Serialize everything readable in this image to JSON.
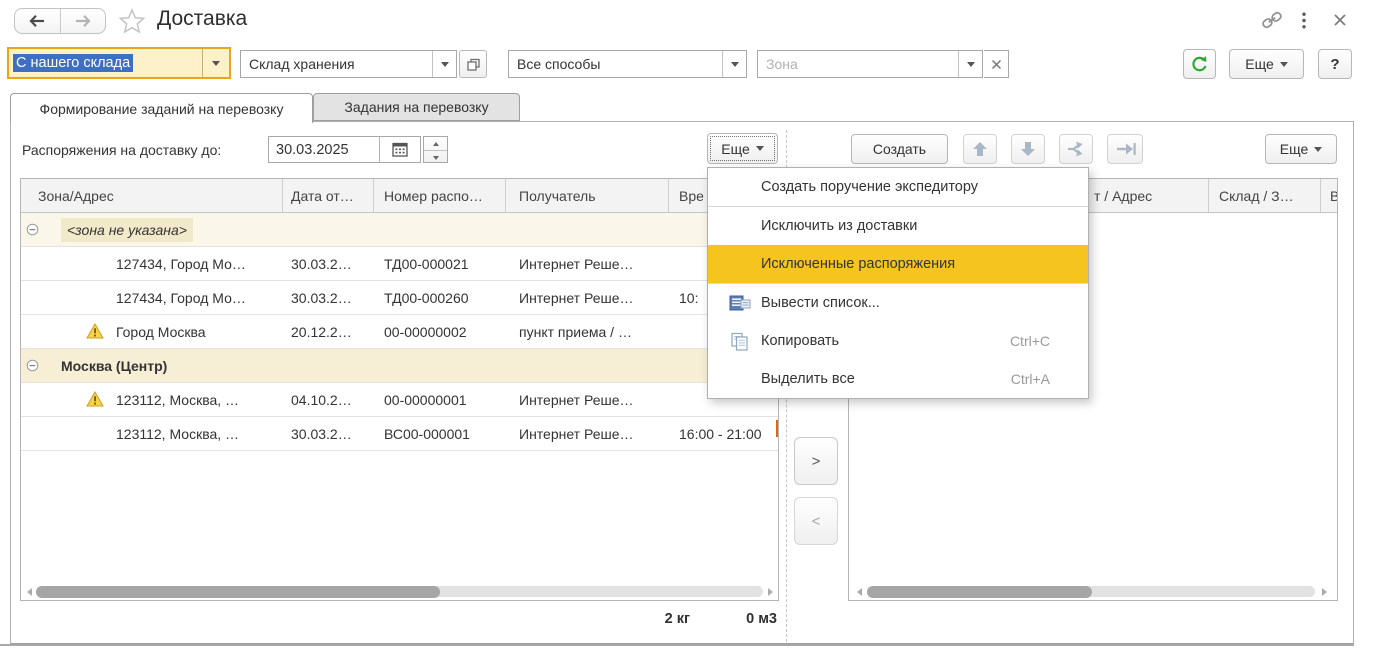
{
  "header": {
    "title": "Доставка"
  },
  "filterbar": {
    "delivery_type": {
      "value": "С нашего склада"
    },
    "warehouse": {
      "value": "Склад хранения"
    },
    "methods": {
      "value": "Все способы"
    },
    "zone": {
      "placeholder": "Зона"
    },
    "more_label": "Еще",
    "help_label": "?"
  },
  "tabs": [
    {
      "label": "Формирование заданий на перевозку",
      "active": true
    },
    {
      "label": "Задания на перевозку",
      "active": false
    }
  ],
  "toolbar": {
    "date_label": "Распоряжения на доставку до:",
    "date_value": "30.03.2025",
    "more_label": "Еще"
  },
  "right_toolbar": {
    "create_label": "Создать",
    "more_label": "Еще"
  },
  "left_table": {
    "columns": [
      "Зона/Адрес",
      "Дата от…",
      "Номер распо…",
      "Получатель",
      "Вре"
    ],
    "rows": [
      {
        "type": "group",
        "label": "<зона не указана>",
        "style": "italic"
      },
      {
        "type": "data",
        "warning": false,
        "address": "127434, Город Мо…",
        "date": "30.03.2…",
        "number": "ТД00-000021",
        "recipient": "Интернет Реше…",
        "time": ""
      },
      {
        "type": "data",
        "warning": false,
        "address": "127434, Город Мо…",
        "date": "30.03.2…",
        "number": "ТД00-000260",
        "recipient": "Интернет Реше…",
        "time": "10:"
      },
      {
        "type": "data",
        "warning": true,
        "address": "Город Москва",
        "date": "20.12.2…",
        "number": "00-00000002",
        "recipient": "пункт приема / …",
        "time": ""
      },
      {
        "type": "group",
        "label": "Москва (Центр)",
        "style": "bold"
      },
      {
        "type": "data",
        "warning": true,
        "address": "123112, Москва, …",
        "date": "04.10.2…",
        "number": "00-00000001",
        "recipient": "Интернет Реше…",
        "time": ""
      },
      {
        "type": "data",
        "warning": false,
        "address": "123112, Москва, …",
        "date": "30.03.2…",
        "number": "ВС00-000001",
        "recipient": "Интернет Реше…",
        "time": "16:00 - 21:00"
      }
    ],
    "totals": {
      "weight": "2 кг",
      "volume": "0 м3"
    }
  },
  "right_table": {
    "columns": [
      "т / Адрес",
      "Склад / З…",
      "В"
    ]
  },
  "transfer": {
    "right": ">",
    "left": "<"
  },
  "context_menu": {
    "items": [
      {
        "label": "Создать поручение экспедитору",
        "sep_after": true
      },
      {
        "label": "Исключить из доставки"
      },
      {
        "label": "Исключенные распоряжения",
        "highlighted": true,
        "sep_after": true
      },
      {
        "label": "Вывести список...",
        "icon": "print-list"
      },
      {
        "label": "Копировать",
        "icon": "copy",
        "shortcut": "Ctrl+C"
      },
      {
        "label": "Выделить все",
        "shortcut": "Ctrl+A"
      }
    ]
  }
}
